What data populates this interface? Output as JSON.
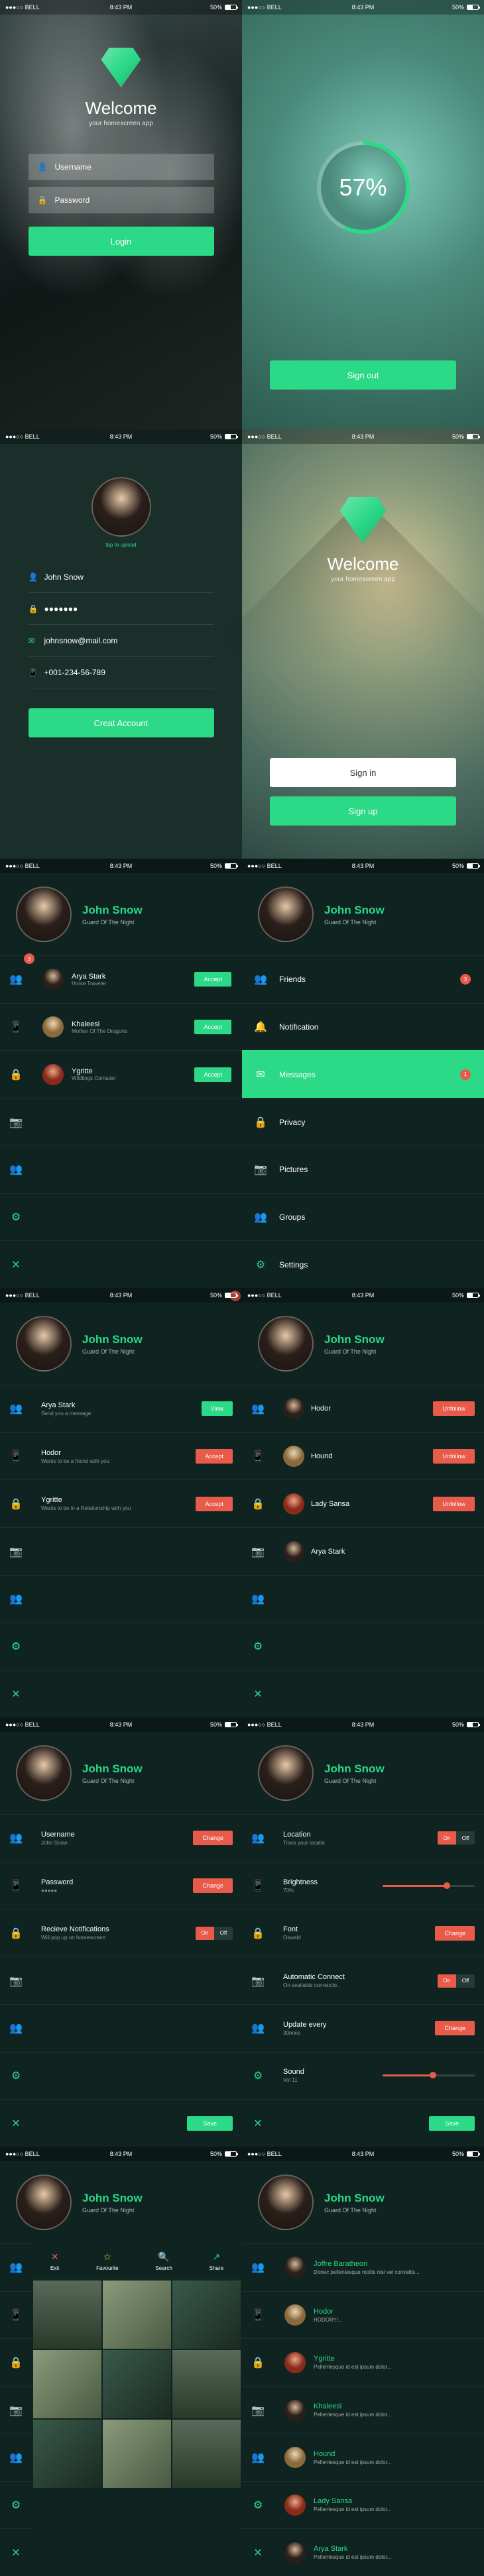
{
  "status": {
    "carrier": "●●●○○ BELL",
    "wifi": "📶",
    "time": "8:43 PM",
    "battery": "50%"
  },
  "colors": {
    "accent": "#2bd987",
    "danger": "#e85a4a",
    "bg": "#0f2420"
  },
  "login": {
    "title": "Welcome",
    "subtitle": "your homescreen app",
    "user_ph": "Username",
    "pass_ph": "Password",
    "btn": "Login"
  },
  "progress": {
    "value": "57%",
    "btn": "Sign out"
  },
  "signup": {
    "hint": "tap to upload",
    "name": "John Snow",
    "email": "johnsnow@mail.com",
    "phone": "+001-234-56-789",
    "btn": "Creat Account"
  },
  "landing": {
    "title": "Welcome",
    "subtitle": "your homescreen app",
    "signin": "Sign in",
    "signup": "Sign up"
  },
  "profile": {
    "name": "John Snow",
    "title": "Guard Of The Night"
  },
  "friends": {
    "items": [
      {
        "name": "Arya Stark",
        "sub": "Horse Traveler",
        "action": "Accept"
      },
      {
        "name": "Khaleesi",
        "sub": "Mother Of The Dragons",
        "action": "Accept"
      },
      {
        "name": "Ygritte",
        "sub": "Wildlings Comader",
        "action": "Accept"
      }
    ],
    "badge_top": "3"
  },
  "menu": {
    "items": [
      "Friends",
      "Notification",
      "Messages",
      "Privacy",
      "Pictures",
      "Groups",
      "Settings"
    ],
    "active": 2,
    "badge_friends": "3",
    "badge_msg": "1"
  },
  "requests": {
    "items": [
      {
        "name": "Arya Stark",
        "msg": "Send you a message",
        "action": "View",
        "style": "g"
      },
      {
        "name": "Hodor",
        "msg": "Wants to be a friend with you",
        "action": "Accept",
        "style": "r"
      },
      {
        "name": "Ygritte",
        "msg": "Wants to be in a Relationship with you",
        "action": "Accept",
        "style": "r"
      }
    ]
  },
  "following": {
    "items": [
      {
        "name": "Hodor",
        "action": "Unfollow"
      },
      {
        "name": "Hound",
        "action": "Unfollow"
      },
      {
        "name": "Lady Sansa",
        "action": "Unfollow"
      },
      {
        "name": "Arya Stark",
        "action": ""
      }
    ]
  },
  "settings1": {
    "items": [
      {
        "label": "Username",
        "sub": "John Snow",
        "ctrl": "Change"
      },
      {
        "label": "Password",
        "sub": "●●●●●",
        "ctrl": "Change"
      },
      {
        "label": "Recieve Notifications",
        "sub": "Will pop up on homescreen",
        "ctrl": "toggle"
      }
    ],
    "save": "Save"
  },
  "settings2": {
    "items": [
      {
        "label": "Location",
        "sub": "Track your locatio",
        "ctrl": "toggle"
      },
      {
        "label": "Brightness",
        "sub": "70%",
        "ctrl": "slider",
        "val": 70
      },
      {
        "label": "Font",
        "sub": "Oswald",
        "ctrl": "Change"
      },
      {
        "label": "Automatic Connect",
        "sub": "On available connectio..",
        "ctrl": "toggle"
      },
      {
        "label": "Update every",
        "sub": "30mins",
        "ctrl": "Change"
      },
      {
        "label": "Sound",
        "sub": "Vol 11",
        "ctrl": "slider",
        "val": 55
      }
    ],
    "save": "Save"
  },
  "gallery": {
    "actions": [
      {
        "icon": "✕",
        "label": "Exit",
        "color": "#e85a4a"
      },
      {
        "icon": "☆",
        "label": "Favourite",
        "color": "#f5c842"
      },
      {
        "icon": "🔍",
        "label": "Search",
        "color": "#4a9ae8"
      },
      {
        "icon": "↗",
        "label": "Share",
        "color": "#2bd987"
      }
    ]
  },
  "chat": {
    "items": [
      {
        "name": "Joffre Baratheon",
        "msg": "Donec pellentesque mollis nisi vel convallis..."
      },
      {
        "name": "Hodor",
        "msg": "HODOR!!!..."
      },
      {
        "name": "Ygritte",
        "msg": "Pellentesque id est ipsum dolor..."
      },
      {
        "name": "Khaleesi",
        "msg": "Pellentesque id est ipsum dolor..."
      },
      {
        "name": "Hound",
        "msg": "Pellentesque id est ipsum dolor..."
      },
      {
        "name": "Lady Sansa",
        "msg": "Pellentesque id est ipsum dolor..."
      },
      {
        "name": "Arya Stark",
        "msg": "Pellentesque id est ipsum dolor..."
      }
    ]
  },
  "toggle": {
    "on": "On",
    "off": "Off"
  }
}
